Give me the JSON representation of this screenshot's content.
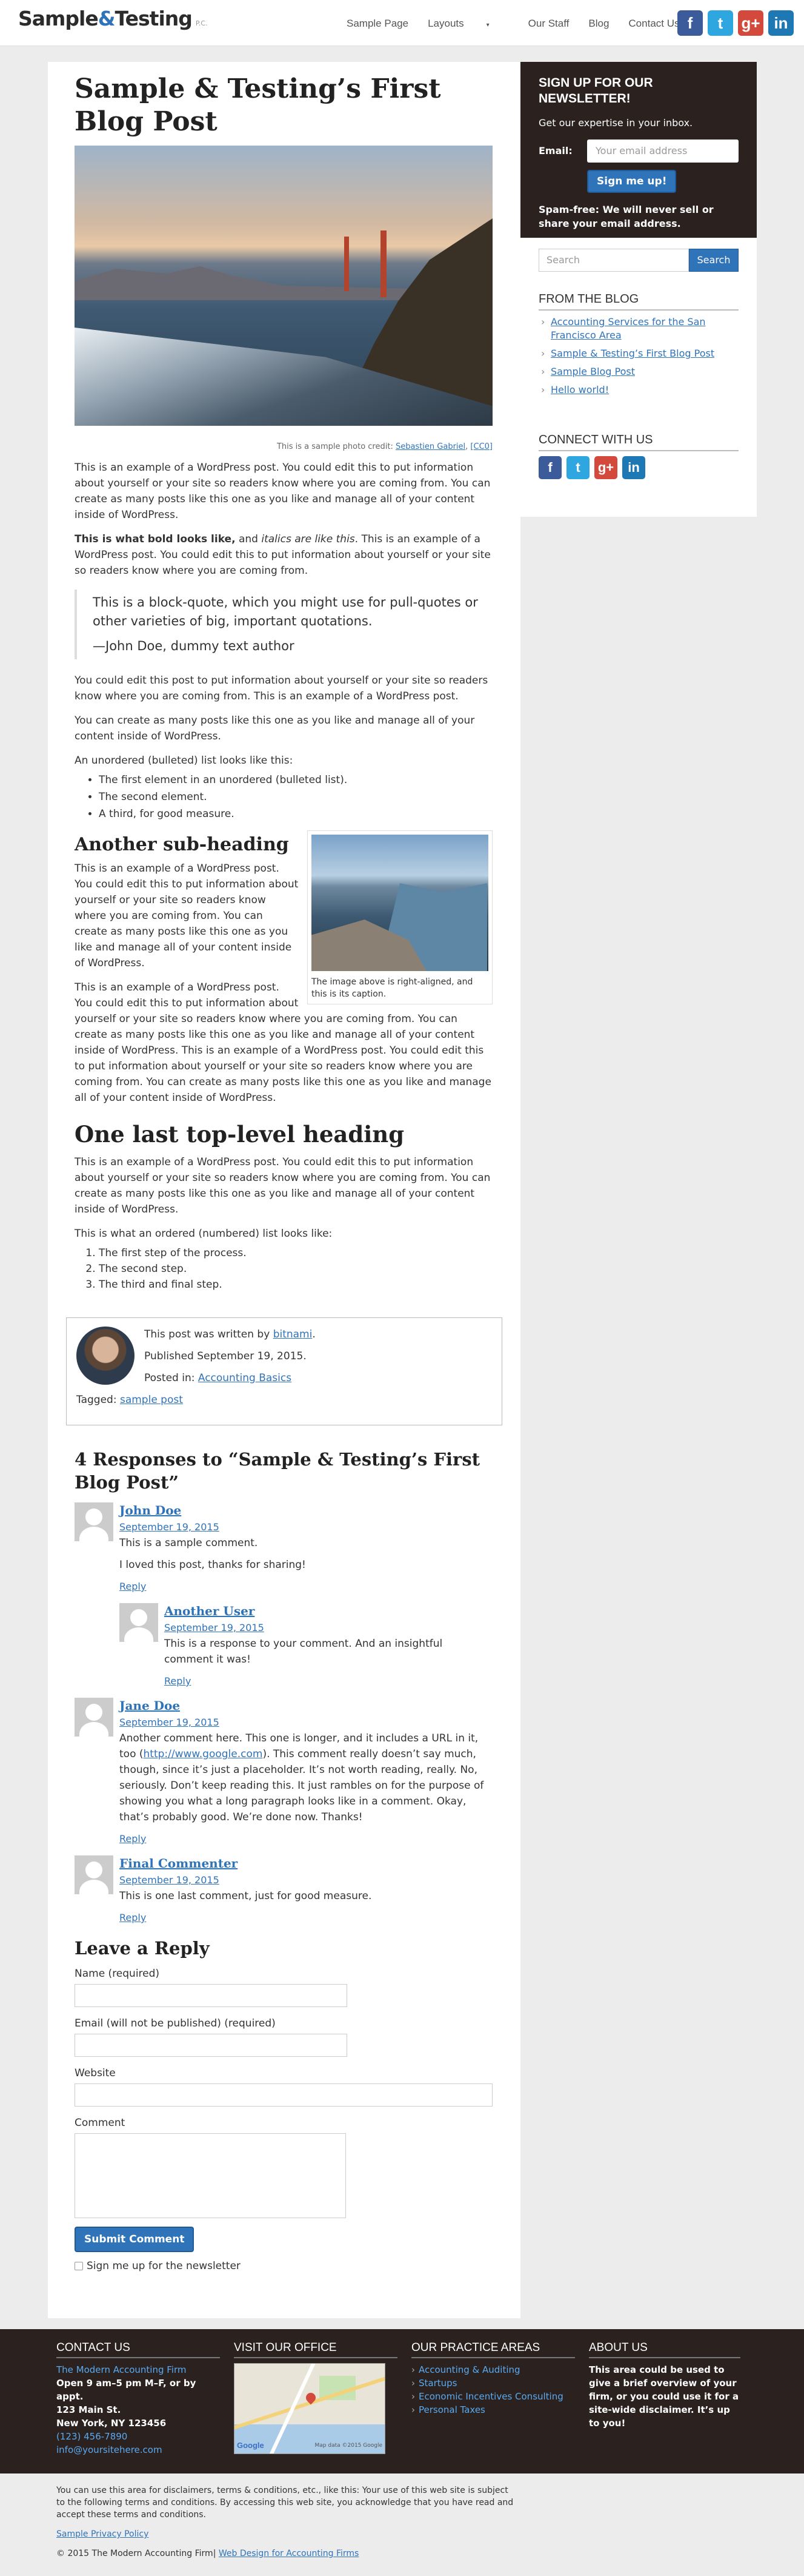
{
  "header": {
    "logo_part1": "Sample",
    "logo_amp": "&",
    "logo_part2": "Testing",
    "logo_suffix": "P.C.",
    "nav": [
      "Sample Page",
      "Layouts",
      "Our Staff",
      "Blog",
      "Contact Us"
    ]
  },
  "social": [
    "facebook-icon",
    "twitter-icon",
    "google-plus-icon",
    "linkedin-icon"
  ],
  "post": {
    "title": "Sample & Testing’s First Blog Post",
    "photo_caption_prefix": "This is a sample photo credit:",
    "photo_credit_link": "Sebastien Gabriel",
    "photo_license_link": "[CC0]",
    "p1": "This is an example of a WordPress post. You could edit this to put information about yourself or your site so readers know where you are coming from. You can create as many posts like this one as you like and manage all of your content inside of WordPress.",
    "p2_bold": "This is what bold looks like,",
    "p2_and": " and ",
    "p2_italic": "italics are like this",
    "p2_rest": ". This is an example of a WordPress post. You could edit this to put information about yourself or your site so readers know where you are coming from.",
    "quote": "This is a block-quote, which you might use for pull-quotes or other varieties of big, important quotations.",
    "quote_cite": "—John Doe, dummy text author",
    "p3": "You could edit this post to put information about yourself or your site so readers know where you are coming from. This is an example of a WordPress post.",
    "p4": "You can create as many posts like this one as you like and manage all of your content inside of WordPress.",
    "ul_intro": "An unordered (bulleted) list looks like this:",
    "ul": [
      "The first element in an unordered (bulleted list).",
      "The second element.",
      "A third, for good measure."
    ],
    "sub_heading": "Another sub-heading",
    "float_caption": "The image above is right-aligned, and this is its caption.",
    "p5": "This is an example of a WordPress post. You could edit this to put information about yourself or your site so readers know where you are coming from. You can create as many posts like this one as you like and manage all of your content inside of WordPress.",
    "p6": "This is an example of a WordPress post. You could edit this to put information about yourself or your site so readers know where you are coming from. You can create as many posts like this one as you like and manage all of your content inside of WordPress. This is an example of a WordPress post. You could edit this to put information about yourself or your site so readers know where you are coming from. You can create as many posts like this one as you like and manage all of your content inside of WordPress.",
    "last_heading": "One last top-level heading",
    "p7": "This is an example of a WordPress post. You could edit this to put information about yourself or your site so readers know where you are coming from. You can create as many posts like this one as you like and manage all of your content inside of WordPress.",
    "ol_intro": "This is what an ordered (numbered) list looks like:",
    "ol": [
      "The first step of the process.",
      "The second step.",
      "The third and final step."
    ]
  },
  "author_box": {
    "written_by": "This post was written by",
    "author": "bitnami",
    "published": "Published September 19, 2015.",
    "posted_in": "Posted in:",
    "category": "Accounting Basics",
    "tagged": "Tagged:",
    "tag": "sample post"
  },
  "comments": {
    "heading": "4 Responses to “Sample & Testing’s First Blog Post”",
    "items": [
      {
        "name": "John Doe",
        "date": "September 19, 2015",
        "p1": "This is a sample comment.",
        "p2": "I loved this post, thanks for sharing!",
        "reply": "Reply"
      },
      {
        "name": "Another User",
        "date": "September 19, 2015",
        "p1": "This is a response to your comment. And an insightful comment it was!",
        "reply": "Reply"
      },
      {
        "name": "Jane Doe",
        "date": "September 19, 2015",
        "p1_a": "Another comment here. This one is longer, and it includes a URL in it, too (",
        "p1_link": "http://www.google.com",
        "p1_b": "). This comment really doesn’t say much, though, since it’s just a placeholder. It’s not worth reading, really. No, seriously. Don’t keep reading this. It just rambles on for the purpose of showing you what a long paragraph looks like in a comment. Okay, that’s probably good. We’re done now. Thanks!",
        "reply": "Reply"
      },
      {
        "name": "Final Commenter",
        "date": "September 19, 2015",
        "p1": "This is one last comment, just for good measure.",
        "reply": "Reply"
      }
    ]
  },
  "reply_form": {
    "heading": "Leave a Reply",
    "name_label": "Name (required)",
    "email_label": "Email (will not be published) (required)",
    "website_label": "Website",
    "comment_label": "Comment",
    "submit": "Submit Comment",
    "newsletter_check": "Sign me up for the newsletter"
  },
  "sidebar": {
    "newsletter_title": "SIGN UP FOR OUR NEWSLETTER!",
    "newsletter_line": "Get our expertise in your inbox.",
    "email_label": "Email:",
    "email_placeholder": "Your email address",
    "signup_button": "Sign me up!",
    "spam_note": "Spam-free: We will never sell or share your email address.",
    "search_placeholder": "Search",
    "search_button": "Search",
    "blog_title": "FROM THE BLOG",
    "blog_items": [
      "Accounting Services for the San Francisco Area",
      "Sample & Testing’s First Blog Post",
      "Sample Blog Post",
      "Hello world!"
    ],
    "connect_title": "CONNECT WITH US"
  },
  "footer": {
    "contact_title": "CONTACT US",
    "firm_name": "The Modern Accounting Firm",
    "hours": "Open 9 am–5 pm M–F, or by appt.",
    "address1": "123 Main St.",
    "address2": "New York, NY 123456",
    "phone": "(123) 456-7890",
    "email": "info@yoursitehere.com",
    "office_title": "VISIT OUR OFFICE",
    "map_logo": "Google",
    "map_data": "Map data ©2015 Google",
    "areas_title": "OUR PRACTICE AREAS",
    "areas": [
      "Accounting & Auditing",
      "Startups",
      "Economic Incentives Consulting",
      "Personal Taxes"
    ],
    "about_title": "ABOUT US",
    "about_text": "This area could be used to give a brief overview of your firm, or you could use it for a site-wide disclaimer. It’s up to you!"
  },
  "legal": {
    "disclaimer": "You can use this area for disclaimers, terms & conditions, etc., like this: Your use of this web site is subject to the following terms and conditions. By accessing this web site, you acknowledge that you have read and accept these terms and conditions.",
    "privacy_link": "Sample Privacy Policy",
    "copyright": "© 2015 The Modern Accounting Firm|",
    "design_link": "Web Design for Accounting Firms"
  },
  "colors": {
    "accent": "#2f73b9",
    "dark": "#2b2220",
    "page_bg": "#ececec"
  }
}
